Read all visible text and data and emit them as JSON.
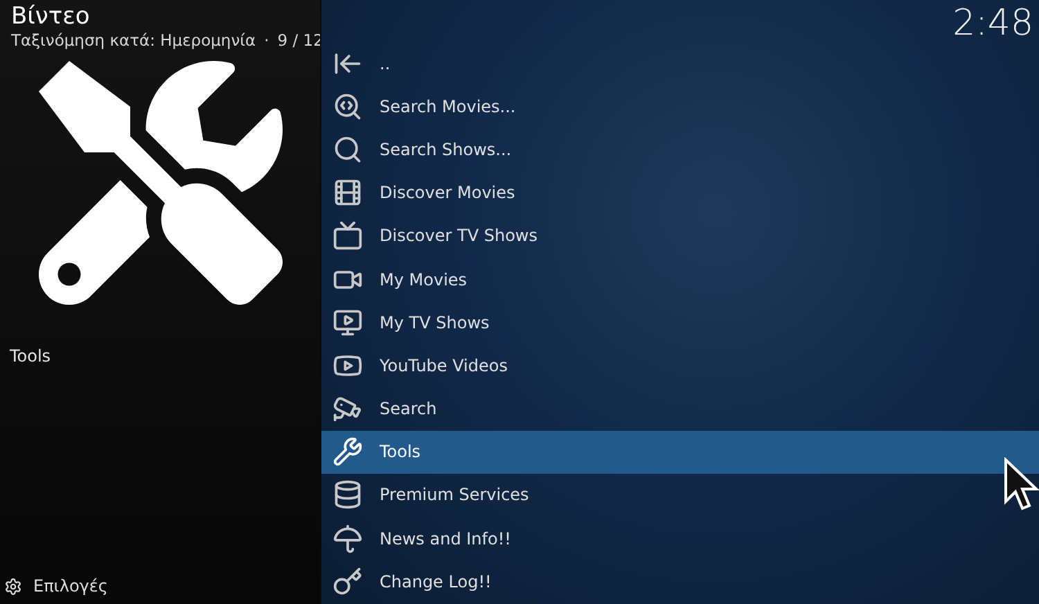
{
  "header": {
    "title": "Βίντεο",
    "sort_label": "Ταξινόμηση κατά: Ημερομηνία",
    "separator": "·",
    "position": "9 / 12"
  },
  "clock": "2:48",
  "preview": {
    "label": "Tools"
  },
  "options_button": {
    "label": "Επιλογές"
  },
  "list": [
    {
      "label": "..",
      "selected": false
    },
    {
      "label": "Search Movies...",
      "selected": false
    },
    {
      "label": "Search Shows...",
      "selected": false
    },
    {
      "label": "Discover Movies",
      "selected": false
    },
    {
      "label": "Discover TV Shows",
      "selected": false
    },
    {
      "label": "My Movies",
      "selected": false
    },
    {
      "label": "My TV Shows",
      "selected": false
    },
    {
      "label": "YouTube Videos",
      "selected": false
    },
    {
      "label": "Search",
      "selected": false
    },
    {
      "label": "Tools",
      "selected": true
    },
    {
      "label": "Premium Services",
      "selected": false
    },
    {
      "label": "News and Info!!",
      "selected": false
    },
    {
      "label": "Change Log!!",
      "selected": false
    }
  ]
}
